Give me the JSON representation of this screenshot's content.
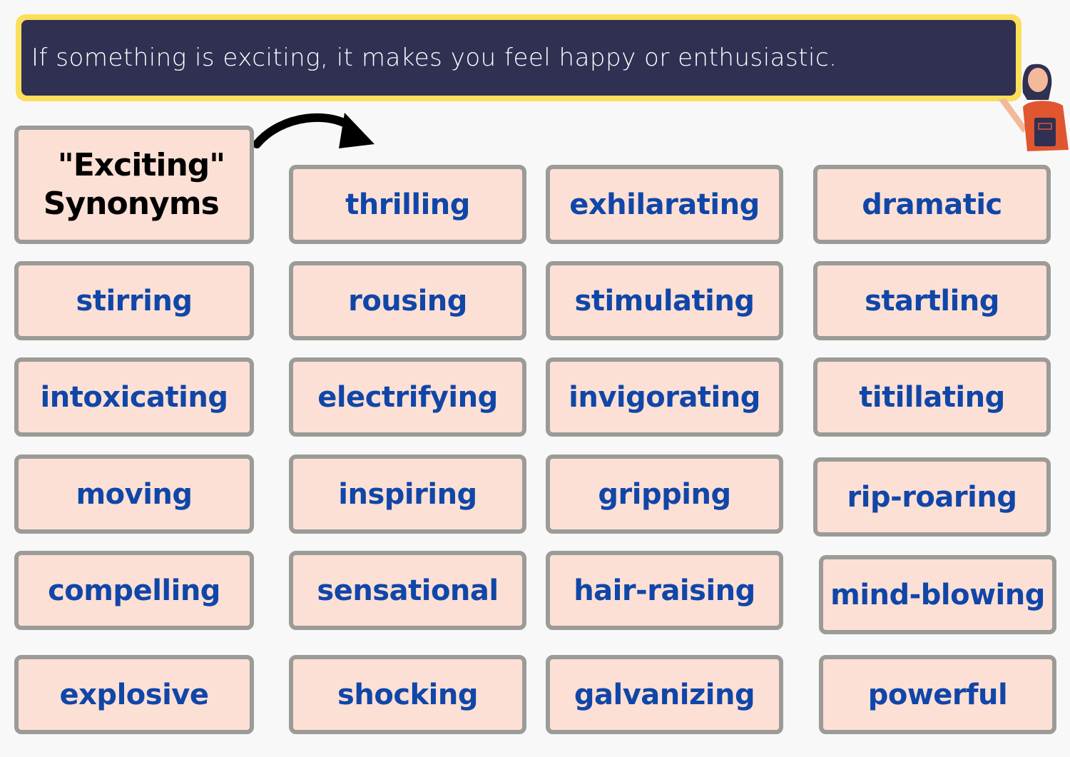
{
  "banner": {
    "text": "If something is exciting, it makes you feel happy or enthusiastic."
  },
  "title_card": {
    "line1": "\"Exciting\"",
    "line2": "Synonyms"
  },
  "colors": {
    "banner_bg": "#2f3052",
    "banner_border": "#fbdf5a",
    "card_bg": "#fde0d5",
    "card_border": "#9b9b97",
    "word_color": "#1046a8"
  },
  "synonyms": [
    "thrilling",
    "exhilarating",
    "dramatic",
    "stirring",
    "rousing",
    "stimulating",
    "startling",
    "intoxicating",
    "electrifying",
    "invigorating",
    "titillating",
    "moving",
    "inspiring",
    "gripping",
    "rip-roaring",
    "compelling",
    "sensational",
    "hair-raising",
    "mind-blowing",
    "explosive",
    "shocking",
    "galvanizing",
    "powerful"
  ]
}
